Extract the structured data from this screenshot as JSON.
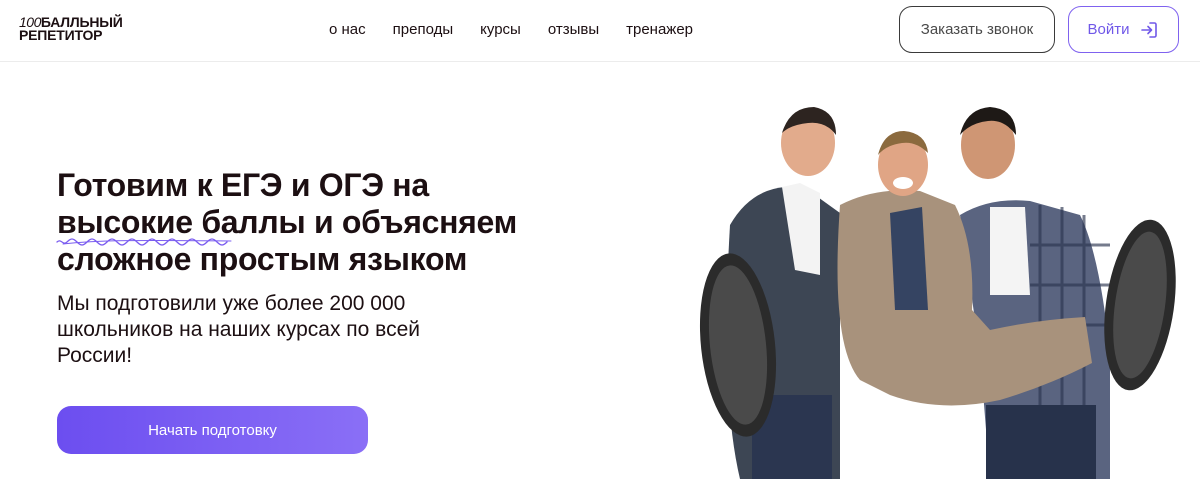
{
  "header": {
    "logo": {
      "line1_number": "100",
      "line1_text": "БАЛЛЬНЫЙ",
      "line2": "РЕПЕТИТОР"
    },
    "nav": [
      {
        "label": "о нас"
      },
      {
        "label": "преподы"
      },
      {
        "label": "курсы"
      },
      {
        "label": "отзывы"
      },
      {
        "label": "тренажер"
      }
    ],
    "call_button": "Заказать звонок",
    "login_button": "Войти",
    "login_icon": "login-arrow-icon"
  },
  "hero": {
    "title_line1": "Готовим к ЕГЭ и ОГЭ на",
    "title_line2_highlight": "высокие",
    "title_line2_rest": " баллы и объясняем",
    "title_line3": "сложное простым языком",
    "subtitle_line1": "Мы подготовили уже более 200 000",
    "subtitle_line2": "школьников на наших курсах по всей",
    "subtitle_line3": "России!",
    "cta_button": "Начать подготовку"
  },
  "colors": {
    "accent": "#7058e8",
    "text": "#1c0f12",
    "cta_gradient_start": "#6c4ef0",
    "cta_gradient_end": "#8a6ff6"
  }
}
